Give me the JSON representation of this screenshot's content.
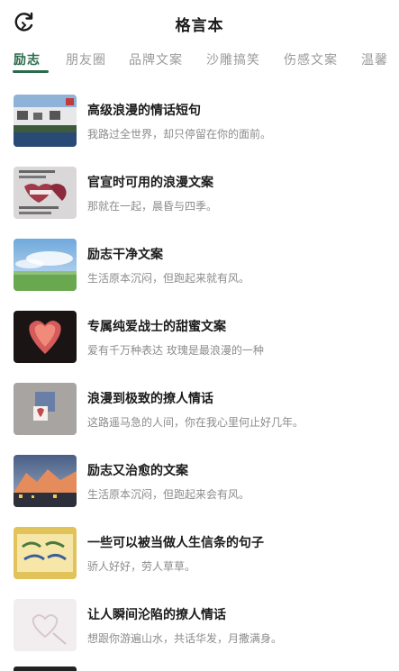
{
  "header": {
    "title": "格言本",
    "refresh_icon": "refresh-icon"
  },
  "tabs": [
    {
      "label": "励志",
      "active": true
    },
    {
      "label": "朋友圈",
      "active": false
    },
    {
      "label": "品牌文案",
      "active": false
    },
    {
      "label": "沙雕搞笑",
      "active": false
    },
    {
      "label": "伤感文案",
      "active": false
    },
    {
      "label": "温馨",
      "active": false
    }
  ],
  "items": [
    {
      "title": "高级浪漫的情话短句",
      "subtitle": "我路过全世界，却只停留在你的面前。"
    },
    {
      "title": "官宣时可用的浪漫文案",
      "subtitle": "那就在一起，晨昏与四季。"
    },
    {
      "title": "励志干净文案",
      "subtitle": "生活原本沉闷，但跑起来就有风。"
    },
    {
      "title": "专属纯爱战士的甜蜜文案",
      "subtitle": "爱有千万种表达 玫瑰是最浪漫的一种"
    },
    {
      "title": "浪漫到极致的撩人情话",
      "subtitle": "这路遥马急的人间，你在我心里何止好几年。"
    },
    {
      "title": "励志又治愈的文案",
      "subtitle": "生活原本沉闷，但跑起来会有风。"
    },
    {
      "title": "一些可以被当做人生信条的句子",
      "subtitle": "骄人好好，劳人草草。"
    },
    {
      "title": "让人瞬间沦陷的撩人情话",
      "subtitle": "想跟你游遍山水，共话华发，月撒满身。"
    }
  ],
  "colors": {
    "accent": "#2b6b4a",
    "muted": "#9a9a9a"
  }
}
